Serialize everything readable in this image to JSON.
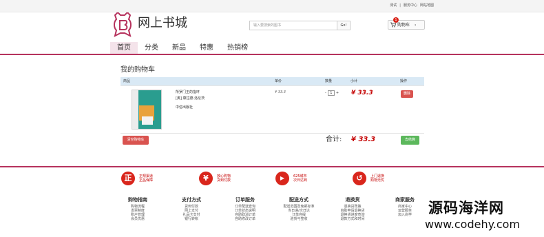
{
  "topbar": {
    "links": [
      "测试",
      "|",
      "服务中心",
      "网站地图"
    ]
  },
  "header": {
    "site_name": "网上书城",
    "search_placeholder": "输入要搜索的图书",
    "search_button": "Go!",
    "cart_label": "购物车",
    "cart_count": "1"
  },
  "nav": {
    "items": [
      "首页",
      "分类",
      "新品",
      "特惠",
      "热销榜"
    ],
    "active": "首页"
  },
  "cart": {
    "title": "我的购物车",
    "columns": {
      "product": "商品",
      "unit_price": "单价",
      "quantity": "数量",
      "subtotal": "小计",
      "action": "操作"
    },
    "item": {
      "name": "所罗门王的指环",
      "author": "[奥] 康拉德·洛伦茨",
      "publisher": "中信出版社",
      "price": "¥ 33.3",
      "quantity": "1",
      "minus": "-",
      "plus": "+",
      "subtotal": "¥ 33.3",
      "delete_label": "删除"
    },
    "clear_label": "清空购物车",
    "total_label": "合计:",
    "total_value": "¥ 33.3",
    "checkout_label": "去结算"
  },
  "features": [
    {
      "icon": "正",
      "icon_name": "genuine-icon",
      "line1": "正规渠道",
      "line2": "正品保障"
    },
    {
      "icon": "¥",
      "icon_name": "yuan-icon",
      "line1": "放心购物",
      "line2": "货到付款"
    },
    {
      "icon": "▶",
      "icon_name": "truck-icon",
      "line1": "625城市",
      "line2": "次日达到"
    },
    {
      "icon": "↺",
      "icon_name": "return-icon",
      "line1": "上门退换",
      "line2": "购物无忧"
    }
  ],
  "footer": {
    "columns": [
      {
        "title": "购物指南",
        "items": [
          "购物流程",
          "发票制度",
          "账户管理",
          "会员优惠"
        ]
      },
      {
        "title": "支付方式",
        "items": [
          "货到付款",
          "网上支付",
          "礼品卡支付",
          "银行转帐"
        ]
      },
      {
        "title": "订单服务",
        "items": [
          "订单配送查询",
          "订单状态说明",
          "自助取消订单",
          "自助修改订单"
        ]
      },
      {
        "title": "配送方式",
        "items": [
          "配送范围及免邮标准",
          "当日递/次日达",
          "订单自提",
          "验货与签收"
        ]
      },
      {
        "title": "退换货",
        "items": [
          "退换货政策",
          "自助申请退换货",
          "退换货进度查询",
          "退款方式和时间"
        ]
      },
      {
        "title": "商家服务",
        "items": [
          "商家中心",
          "运营服务",
          "加入尚学"
        ]
      }
    ]
  },
  "watermark": {
    "line1": "源码海洋网",
    "line2": "www.codehy.com"
  },
  "colors": {
    "brand": "#b6325d",
    "price": "#c40000",
    "danger": "#d9534f",
    "success": "#5cb85c"
  }
}
